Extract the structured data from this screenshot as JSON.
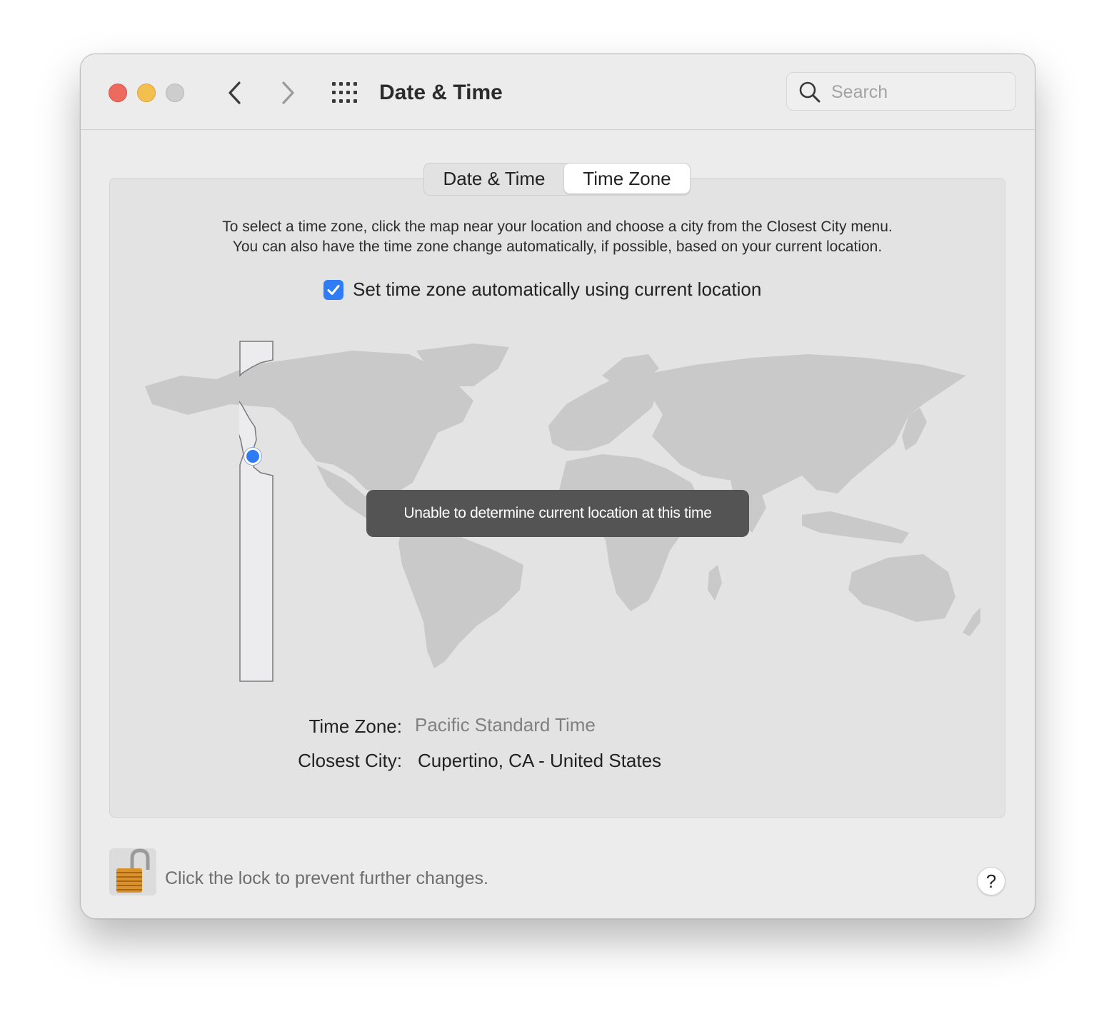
{
  "window": {
    "title": "Date & Time"
  },
  "toolbar": {
    "back_icon": "chevron-left-icon",
    "forward_icon": "chevron-right-icon",
    "grid_icon": "grid-icon"
  },
  "search": {
    "placeholder": "Search",
    "value": ""
  },
  "tabs": [
    {
      "label": "Date & Time",
      "selected": false
    },
    {
      "label": "Time Zone",
      "selected": true
    }
  ],
  "description": {
    "line1": "To select a time zone, click the map near your location and choose a city from the Closest City menu.",
    "line2": "You can also have the time zone change automatically, if possible, based on your current location."
  },
  "auto_location": {
    "label": "Set time zone automatically using current location",
    "checked": true
  },
  "map": {
    "toast": "Unable to determine current location at this time"
  },
  "details": {
    "time_zone_label": "Time Zone:",
    "time_zone_value": "Pacific Standard Time",
    "closest_city_label": "Closest City:",
    "closest_city_value": "Cupertino, CA - United States"
  },
  "footer": {
    "lock_text": "Click the lock to prevent further changes.",
    "help_label": "?"
  },
  "colors": {
    "accent": "#2f7cf6",
    "close": "#ed6a5e",
    "minimize": "#f5bf4f",
    "zoom": "#cdcdcd",
    "land": "#c8c8c8",
    "toast_bg": "#545454"
  }
}
